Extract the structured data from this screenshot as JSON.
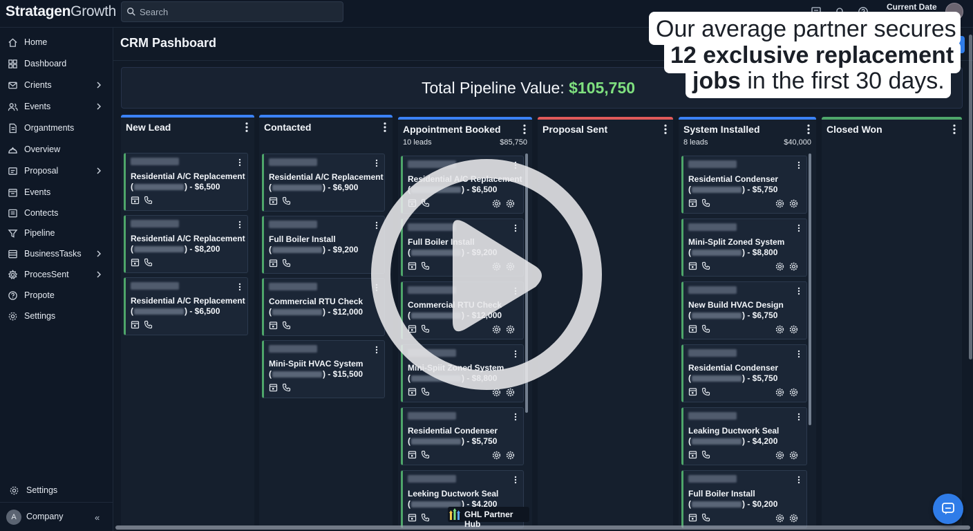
{
  "app": {
    "logo_bold": "Stratagen",
    "logo_light": "Growth"
  },
  "search": {
    "placeholder": "Search"
  },
  "header": {
    "current_date_label": "Current Date"
  },
  "sidebar": {
    "items": [
      {
        "label": "Home",
        "icon": "home-icon",
        "chevron": false
      },
      {
        "label": "Dashboard",
        "icon": "grid-icon",
        "chevron": false
      },
      {
        "label": "Crients",
        "icon": "mail-icon",
        "chevron": true
      },
      {
        "label": "Events",
        "icon": "users-icon",
        "chevron": true
      },
      {
        "label": "Organtments",
        "icon": "document-icon",
        "chevron": false
      },
      {
        "label": "Overview",
        "icon": "chart-icon",
        "chevron": false
      },
      {
        "label": "Proposal",
        "icon": "folder-icon",
        "chevron": true
      },
      {
        "label": "Events",
        "icon": "calendar-icon",
        "chevron": false
      },
      {
        "label": "Contects",
        "icon": "contact-icon",
        "chevron": false
      },
      {
        "label": "Pipeline",
        "icon": "funnel-icon",
        "chevron": false
      },
      {
        "label": "BusinessTasks",
        "icon": "tasks-icon",
        "chevron": true
      },
      {
        "label": "ProcesSent",
        "icon": "gear-icon",
        "chevron": true
      },
      {
        "label": "Propote",
        "icon": "help-icon",
        "chevron": false
      },
      {
        "label": "Settings",
        "icon": "settings-icon",
        "chevron": false
      }
    ],
    "bottom_settings": "Settings",
    "company": {
      "avatar_letter": "A",
      "label": "Company",
      "collapse": "«"
    }
  },
  "page": {
    "title": "CRM Pashboard"
  },
  "pipeline": {
    "label": "Total Pipeline Value:",
    "value": "$105,750"
  },
  "columns": [
    {
      "name": "New Lead",
      "accent": "#3b82f6",
      "leads": "",
      "total": "",
      "cards": [
        {
          "line1": "Residential A/C Replacement",
          "price": ") - $6,500",
          "gears": false
        },
        {
          "line1": "Residential A/C Replacement",
          "price": ") - $8,200",
          "gears": false
        },
        {
          "line1": "Residential A/C Replacement",
          "price": ") - $6,500",
          "gears": false
        }
      ]
    },
    {
      "name": "Contacted",
      "accent": "#3b82f6",
      "leads": "",
      "total": "",
      "cards": [
        {
          "line1": "Residential A/C Replacement",
          "price": ") - $6,900",
          "gears": false
        },
        {
          "line1": "Full Boiler Install",
          "price": ") - $9,200",
          "gears": false
        },
        {
          "line1": "Commercial RTU Check",
          "price": ") - $12,000",
          "gears": false
        },
        {
          "line1": "Mini-Spiit HVAC System",
          "price": ") - $15,500",
          "gears": false
        }
      ]
    },
    {
      "name": "Appointment Booked",
      "accent": "#3b82f6",
      "leads": "10 leads",
      "total": "$85,750",
      "cards": [
        {
          "line1": "Residential A/C Replacement",
          "price": ") - $6,500",
          "gears": true
        },
        {
          "line1": "Full Boiler Install",
          "price": ") - $9,200",
          "gears": true
        },
        {
          "line1": "Commercial RTU Check",
          "price": ") - $12,000",
          "gears": true
        },
        {
          "line1": "Mini-Spiit Zoned System",
          "price": ") - $8,800",
          "gears": true
        },
        {
          "line1": "Residential Condenser",
          "price": ") - $5,750",
          "gears": true
        },
        {
          "line1": "Leeking Ductwork Seal",
          "price": ") - $4,200",
          "gears": false
        }
      ]
    },
    {
      "name": "Proposal Sent",
      "accent": "#e05a5a",
      "leads": "",
      "total": "",
      "cards": []
    },
    {
      "name": "System Installed",
      "accent": "#3b82f6",
      "leads": "8 leads",
      "total": "$40,000",
      "cards": [
        {
          "line1": "Residential Condenser",
          "price": ") - $5,750",
          "gears": true
        },
        {
          "line1": "Mini-Split Zoned System",
          "price": ") - $8,800",
          "gears": true
        },
        {
          "line1": "New Build HVAC Design",
          "price": ") - $6,750",
          "gears": true
        },
        {
          "line1": "Residential Condenser",
          "price": ") - $5,750",
          "gears": true
        },
        {
          "line1": "Leaking Ductwork Seal",
          "price": ") - $4,200",
          "gears": true
        },
        {
          "line1": "Full Boiler Install",
          "price": ") - $0,200",
          "gears": true
        }
      ]
    },
    {
      "name": "Closed Won",
      "accent": "#4ea66a",
      "leads": "",
      "total": "",
      "cards": []
    }
  ],
  "overlay": {
    "line1": "Our average partner secures",
    "line2_bold": "12 exclusive replacement",
    "line3_bold": "jobs",
    "line3_rest": " in the first 30 days."
  },
  "hub": {
    "label": "GHL Partner Hub"
  },
  "colors": {
    "accent_blue": "#3b82f6",
    "pipeline_green": "#7fe07f",
    "card_border_green": "#4ea66a",
    "proposal_red": "#e05a5a"
  }
}
